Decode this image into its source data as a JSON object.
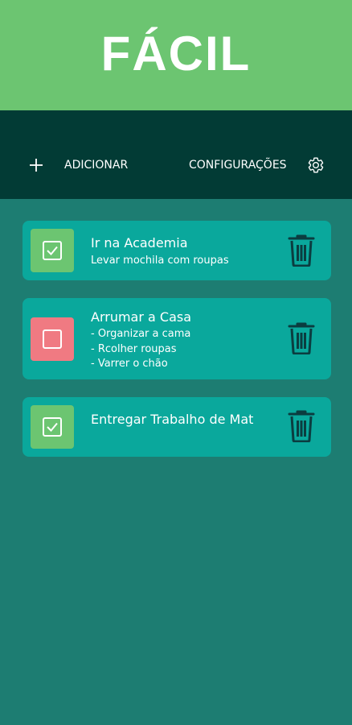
{
  "header": {
    "title": "FÁCIL",
    "background": "#6cc571"
  },
  "toolbar": {
    "add_label": "ADICIONAR",
    "add_icon": "plus-icon",
    "settings_label": "CONFIGURAÇÕES",
    "settings_icon": "gear-icon",
    "background": "#023b35"
  },
  "tasks": [
    {
      "title": "Ir na Academia",
      "description": [
        "Levar mochila com roupas"
      ],
      "completed": true,
      "delete_icon": "trash-icon"
    },
    {
      "title": "Arrumar a Casa",
      "description": [
        "- Organizar a cama",
        "- Rcolher roupas",
        "- Varrer o chão"
      ],
      "completed": false,
      "delete_icon": "trash-icon"
    },
    {
      "title": "Entregar Trabalho de Mat",
      "description": [],
      "completed": true,
      "delete_icon": "trash-icon"
    }
  ],
  "colors": {
    "page_background": "#1d7d72",
    "card": "#0aa89c",
    "checked": "#6cc571",
    "unchecked": "#f07a82",
    "trash": "#0b3d40"
  }
}
